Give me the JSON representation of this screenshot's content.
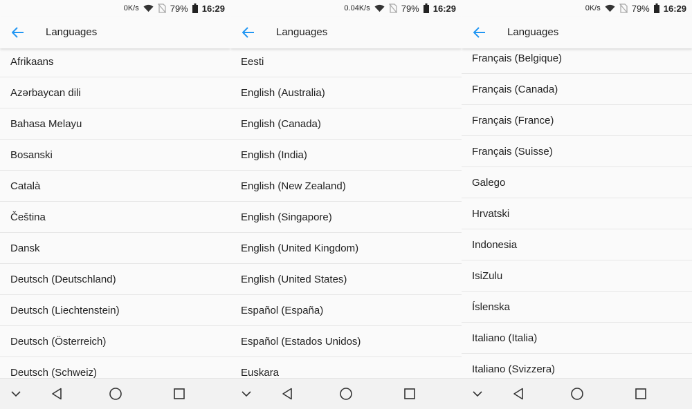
{
  "accent_color": "#2196f3",
  "screens": [
    {
      "status": {
        "net_speed": "0K/s",
        "battery": "79%",
        "time": "16:29"
      },
      "title": "Languages",
      "items": [
        "Afrikaans",
        "Azərbaycan dili",
        "Bahasa Melayu",
        "Bosanski",
        "Català",
        "Čeština",
        "Dansk",
        "Deutsch (Deutschland)",
        "Deutsch (Liechtenstein)",
        "Deutsch (Österreich)",
        "Deutsch (Schweiz)"
      ]
    },
    {
      "status": {
        "net_speed": "0.04K/s",
        "battery": "79%",
        "time": "16:29"
      },
      "title": "Languages",
      "items": [
        "Eesti",
        "English (Australia)",
        "English (Canada)",
        "English (India)",
        "English (New Zealand)",
        "English (Singapore)",
        "English (United Kingdom)",
        "English (United States)",
        "Español (España)",
        "Español (Estados Unidos)",
        "Euskara"
      ]
    },
    {
      "status": {
        "net_speed": "0K/s",
        "battery": "79%",
        "time": "16:29"
      },
      "title": "Languages",
      "items": [
        "Français (Belgique)",
        "Français (Canada)",
        "Français (France)",
        "Français (Suisse)",
        "Galego",
        "Hrvatski",
        "Indonesia",
        "IsiZulu",
        "Íslenska",
        "Italiano (Italia)",
        "Italiano (Svizzera)"
      ]
    }
  ]
}
